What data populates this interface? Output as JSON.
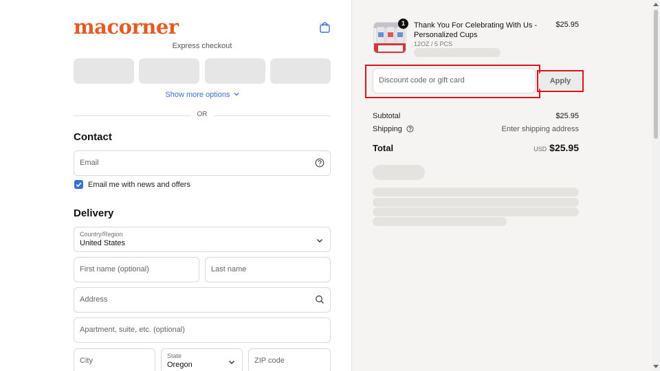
{
  "brand": {
    "logo_text": "macorner",
    "logo_color": "#e35b25"
  },
  "header": {
    "cart_icon": "shopping-bag-icon"
  },
  "express": {
    "label": "Express checkout",
    "buttons_count": 4,
    "show_more": "Show more options",
    "or": "OR"
  },
  "contact": {
    "title": "Contact",
    "email_placeholder": "Email",
    "newsletter_label": "Email me with news and offers",
    "newsletter_checked": true
  },
  "delivery": {
    "title": "Delivery",
    "country_label": "Country/Region",
    "country_value": "United States",
    "first_name_placeholder": "First name (optional)",
    "last_name_placeholder": "Last name",
    "address_placeholder": "Address",
    "apartment_placeholder": "Apartment, suite, etc. (optional)",
    "city_placeholder": "City",
    "state_label": "State",
    "state_value": "Oregon",
    "zip_placeholder": "ZIP code"
  },
  "summary": {
    "product": {
      "name": "Thank You For Celebrating With Us - Personalized Cups",
      "variant": "12OZ / 5 PCS",
      "price": "$25.95",
      "quantity": "1"
    },
    "discount_placeholder": "Discount code or gift card",
    "apply_label": "Apply",
    "subtotal_label": "Subtotal",
    "subtotal_value": "$25.95",
    "shipping_label": "Shipping",
    "shipping_value": "Enter shipping address",
    "total_label": "Total",
    "total_currency": "USD",
    "total_value": "$25.95"
  },
  "colors": {
    "accent": "#3b6fd6",
    "highlight": "#e0101b",
    "summary_bg": "#f5f4f2"
  }
}
